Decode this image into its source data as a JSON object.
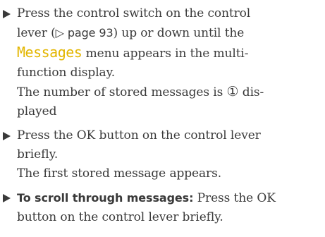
{
  "steps": [
    {
      "line1": "Press the control switch on the control",
      "line2_a": "lever (",
      "page_ref": "▷ page 93",
      "line2_b": ") up or down until the",
      "menu_name": "Messages",
      "line3_b": " menu appears in the multi-",
      "line4": "function display.",
      "result_a": "The number of stored messages is ",
      "marker": "①",
      "result_b": " dis-",
      "result_c": "played"
    },
    {
      "line1": "Press the OK button on the control lever",
      "line2": "briefly.",
      "result": "The first stored message appears."
    },
    {
      "bold_label": "To scroll through messages:",
      "line1_rest": " Press the OK",
      "line2": "button on the control lever briefly."
    }
  ]
}
